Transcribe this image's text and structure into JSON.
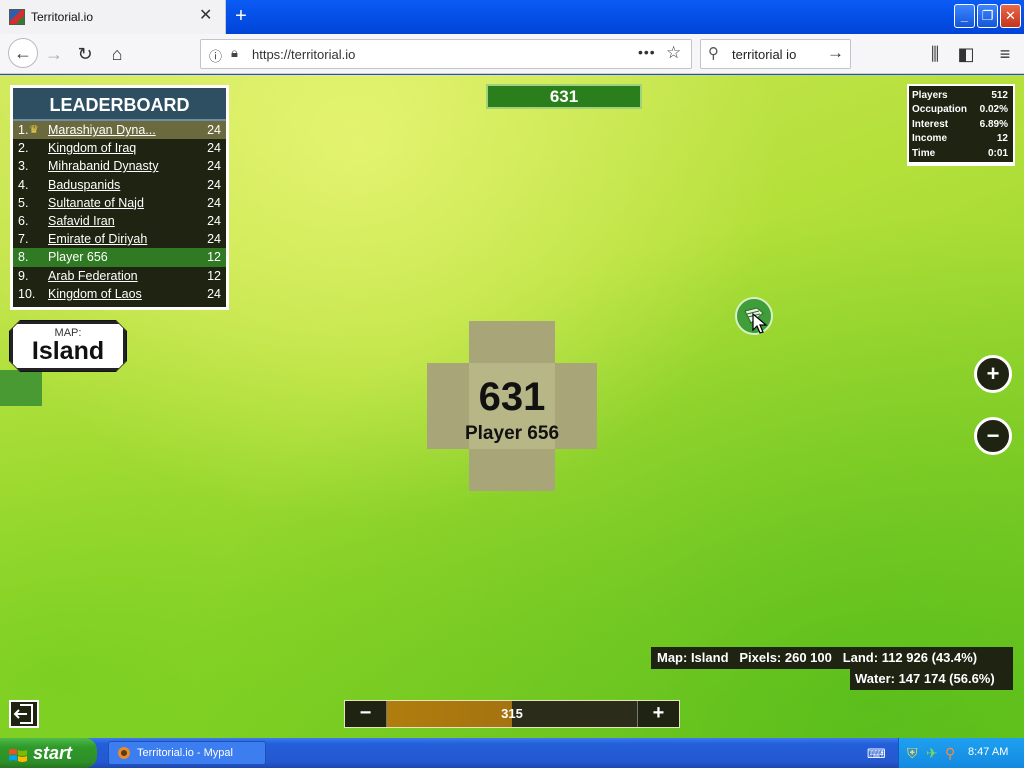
{
  "browser": {
    "tab_title": "Territorial.io",
    "url": "https://territorial.io",
    "search_text": "territorial io"
  },
  "leaderboard": {
    "title": "LEADERBOARD",
    "rows": [
      {
        "rank": "1.",
        "name": "Marashiyan Dyna...",
        "score": "24"
      },
      {
        "rank": "2.",
        "name": "Kingdom of Iraq",
        "score": "24"
      },
      {
        "rank": "3.",
        "name": "Mihrabanid Dynasty",
        "score": "24"
      },
      {
        "rank": "4.",
        "name": "Baduspanids",
        "score": "24"
      },
      {
        "rank": "5.",
        "name": "Sultanate of Najd",
        "score": "24"
      },
      {
        "rank": "6.",
        "name": "Safavid Iran",
        "score": "24"
      },
      {
        "rank": "7.",
        "name": "Emirate of Diriyah",
        "score": "24"
      },
      {
        "rank": "8.",
        "name": "Player 656",
        "score": "12"
      },
      {
        "rank": "9.",
        "name": "Arab Federation",
        "score": "12"
      },
      {
        "rank": "10.",
        "name": "Kingdom of Laos",
        "score": "24"
      }
    ]
  },
  "map_badge": {
    "label": "MAP:",
    "name": "Island"
  },
  "troop_bar": {
    "value": "631"
  },
  "stats": {
    "rows": [
      {
        "label": "Players",
        "value": "512"
      },
      {
        "label": "Occupation",
        "value": "0.02%"
      },
      {
        "label": "Interest",
        "value": "6.89%"
      },
      {
        "label": "Income",
        "value": "12"
      },
      {
        "label": "Time",
        "value": "0:01"
      }
    ]
  },
  "territory": {
    "troops": "631",
    "player_name": "Player 656"
  },
  "map_info": {
    "line1": "Map: Island   Pixels: 260 100   Land: 112 926 (43.4%)",
    "line2": "Water: 147 174 (56.6%)"
  },
  "attack_bar": {
    "minus": "−",
    "plus": "+",
    "value": "315",
    "fill_fraction": 0.5
  },
  "zoom": {
    "in": "+",
    "out": "−"
  },
  "taskbar": {
    "start_label": "start",
    "task_label": "Territorial.io - Mypal",
    "clock": "8:47 AM"
  },
  "colors": {
    "player_territory": "#a8a679",
    "panel_bg": "#1f2412",
    "player_highlight": "#2f7a22",
    "attack_fill": "#b07d0e"
  }
}
